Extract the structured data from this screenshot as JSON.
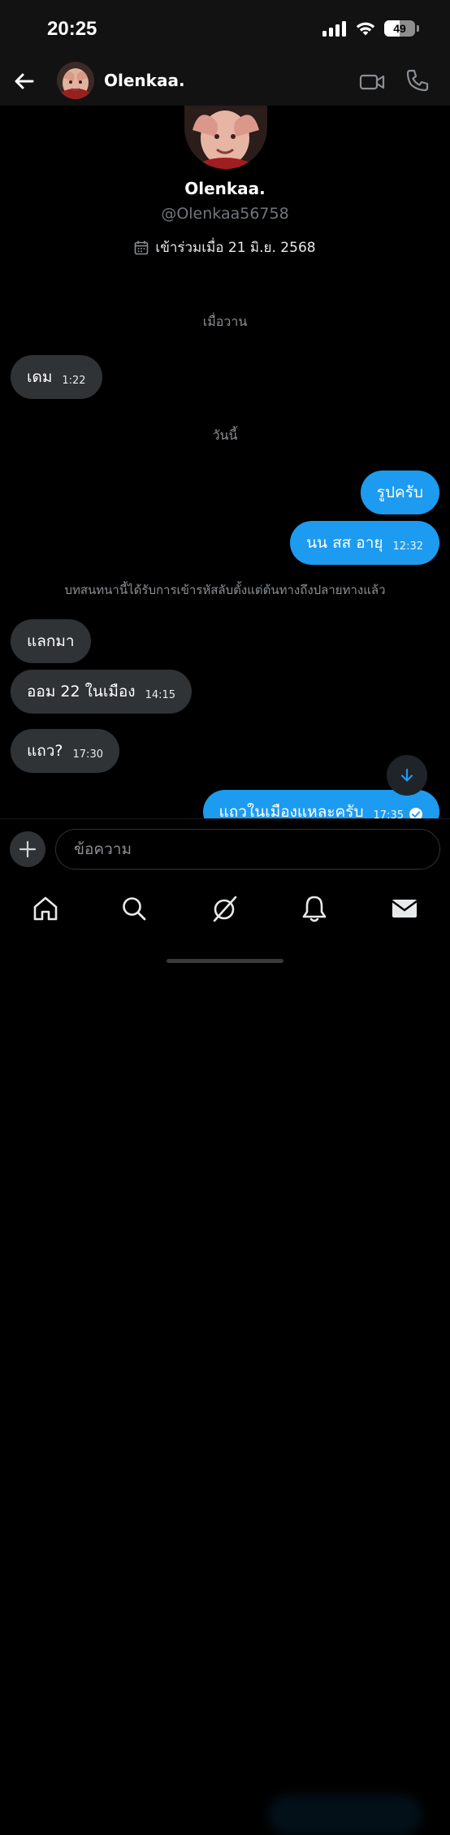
{
  "status_bar": {
    "time": "20:25",
    "battery": "49",
    "battery_level": 0.49
  },
  "header": {
    "name": "Olenkaa."
  },
  "profile": {
    "name": "Olenkaa.",
    "handle": "@Olenkaa56758",
    "joined": "เข้าร่วมเมื่อ 21 มิ.ย. 2568"
  },
  "conversation": {
    "date_yesterday": "เมื่อวาน",
    "date_today": "วันนี้",
    "encryption_notice": "บทสนทนานี้ได้รับการเข้ารหัสลับตั้งแต่ต้นทางถึงปลายทางแล้ว",
    "messages": [
      {
        "direction": "in",
        "text": "เดม",
        "time": "1:22"
      },
      {
        "direction": "out",
        "text": "รูปครับ",
        "time": ""
      },
      {
        "direction": "out",
        "text": "นน สส อายุ",
        "time": "12:32"
      },
      {
        "direction": "in",
        "text": "แลกมา",
        "time": ""
      },
      {
        "direction": "in",
        "text": "ออม 22 ในเมือง",
        "time": "14:15"
      },
      {
        "direction": "in",
        "text": "แถว?",
        "time": "17:30"
      },
      {
        "direction": "out",
        "text": "แถวในเมืองแหละครับ",
        "time": "17:35"
      }
    ]
  },
  "composer": {
    "placeholder": "ข้อความ"
  },
  "colors": {
    "accent": "#1d9bf0",
    "incoming_bubble": "#2f3336",
    "background": "#000000"
  },
  "icons": {
    "back": "arrow-left-icon",
    "video": "video-camera-icon",
    "call": "phone-icon",
    "calendar": "calendar-icon",
    "scroll": "arrow-down-icon",
    "plus": "plus-icon",
    "tabs": [
      "home-icon",
      "search-icon",
      "grok-icon",
      "bell-icon",
      "mail-icon"
    ]
  }
}
